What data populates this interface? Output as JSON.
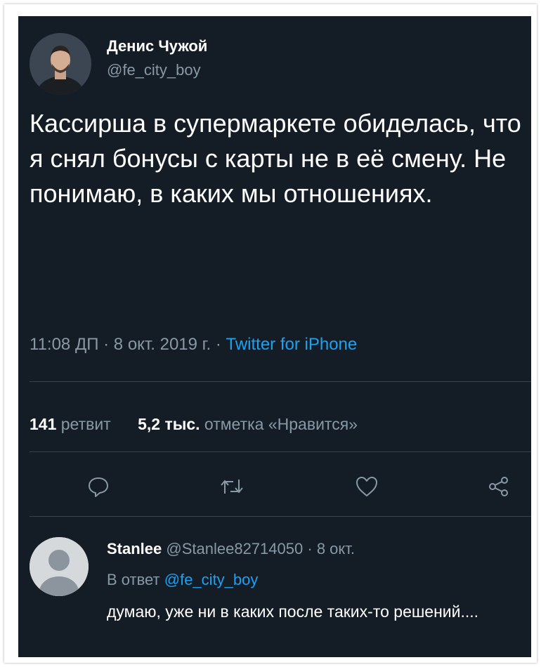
{
  "tweet": {
    "author_name": "Денис Чужой",
    "author_handle": "@fe_city_boy",
    "text": "Кассирша в супермаркете обиделась, что я снял бонусы с карты не в её смену. Не понимаю, в каких мы отношениях.",
    "time": "11:08 ДП",
    "date": "8 окт. 2019 г.",
    "separator": "·",
    "source": "Twitter for iPhone"
  },
  "stats": {
    "retweets_count": "141",
    "retweets_label": "ретвит",
    "likes_count": "5,2 тыс.",
    "likes_label": "отметка «Нравится»"
  },
  "actions": {
    "icons": [
      "reply-icon",
      "retweet-icon",
      "like-icon",
      "share-icon"
    ]
  },
  "reply": {
    "author_name": "Stanlee",
    "author_handle": "@Stanlee82714050",
    "separator": "·",
    "date": "8 окт.",
    "reply_to_label": "В ответ",
    "reply_to_handle": "@fe_city_boy",
    "text": "думаю, уже ни в каких после таких-то решений...."
  },
  "colors": {
    "background": "#141d26",
    "text": "#ffffff",
    "secondary": "#8899a6",
    "accent": "#1da1f2",
    "divider": "#38444d"
  }
}
